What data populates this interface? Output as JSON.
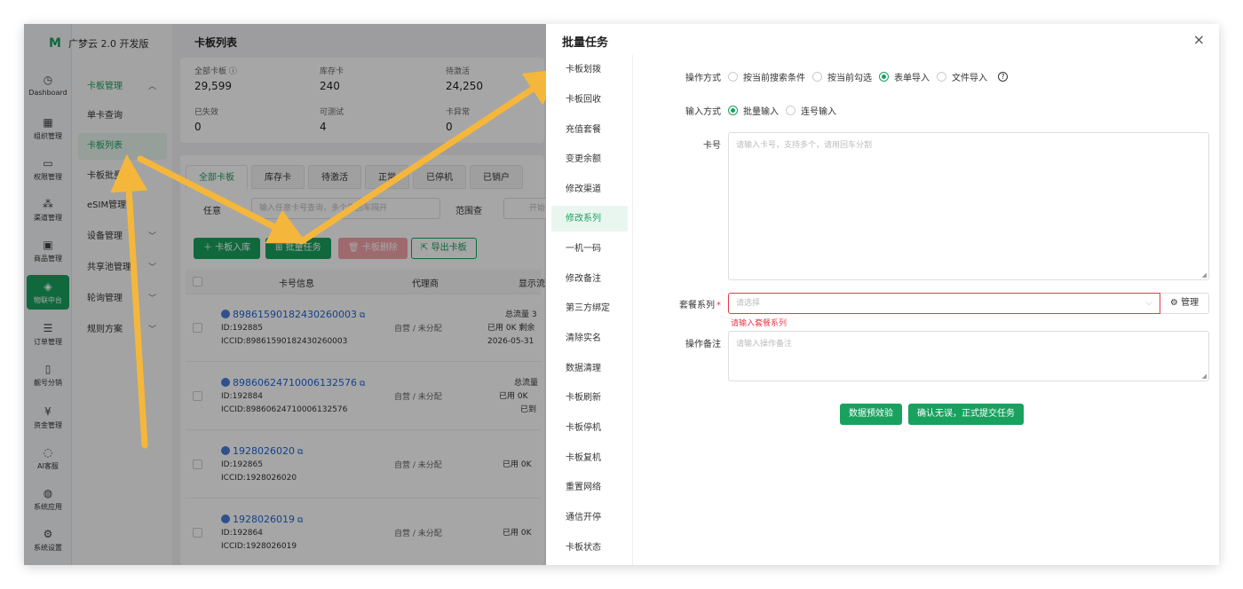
{
  "app": {
    "brand": "广梦云 2.0 开发版"
  },
  "nav_primary": [
    {
      "label": "Dashboard",
      "icon": "dashboard-icon"
    },
    {
      "label": "组织管理",
      "icon": "org-icon"
    },
    {
      "label": "权限管理",
      "icon": "permission-icon"
    },
    {
      "label": "渠道管理",
      "icon": "channel-icon"
    },
    {
      "label": "商品管理",
      "icon": "goods-icon"
    },
    {
      "label": "物联中台",
      "icon": "iot-icon",
      "active": true
    },
    {
      "label": "订单管理",
      "icon": "order-icon"
    },
    {
      "label": "靓号分销",
      "icon": "phone-icon"
    },
    {
      "label": "资金管理",
      "icon": "funds-icon"
    },
    {
      "label": "AI客服",
      "icon": "ai-icon"
    },
    {
      "label": "系统应用",
      "icon": "apps-icon"
    },
    {
      "label": "系统设置",
      "icon": "settings-icon"
    }
  ],
  "nav_secondary": {
    "group": "卡板管理",
    "items": [
      "单卡查询",
      "卡板列表",
      "卡板批量",
      "eSIM管理",
      "设备管理",
      "共享池管理",
      "轮询管理",
      "规则方案"
    ]
  },
  "page": {
    "title": "卡板列表",
    "stats": [
      {
        "label": "全部卡板",
        "value": "29,599"
      },
      {
        "label": "库存卡",
        "value": "240"
      },
      {
        "label": "待激活",
        "value": "24,250"
      },
      {
        "label": "已失效",
        "value": "0"
      },
      {
        "label": "可测试",
        "value": "4"
      },
      {
        "label": "卡异常",
        "value": "0"
      }
    ],
    "tabs": [
      "全部卡板",
      "库存卡",
      "待激活",
      "正常",
      "已停机",
      "已销户"
    ],
    "filter": {
      "any_label": "任意",
      "any_placeholder": "输入任意卡号查询，多个用回车隔开",
      "range_label": "范围查",
      "range_placeholder": "开始"
    },
    "toolbar": {
      "import": "＋ 卡板入库",
      "batch": "批量任务",
      "delete": "卡板删除",
      "export": "导出卡板"
    },
    "table": {
      "headers": [
        "卡号信息",
        "代理商",
        "显示流"
      ],
      "rows": [
        {
          "number": "89861590182430260003",
          "id": "ID:192885",
          "iccid": "ICCID:89861590182430260003",
          "agent": "自营 / 未分配",
          "flow1": "总流量 3",
          "flow2": "已用 0K  剩余",
          "flow3": "2026-05-31"
        },
        {
          "number": "89860624710006132576",
          "id": "ID:192884",
          "iccid": "ICCID:89860624710006132576",
          "agent": "自营 / 未分配",
          "flow1": "总流量",
          "flow2": "已用 0K",
          "flow3": "已到"
        },
        {
          "number": "1928026020",
          "id": "ID:192865",
          "iccid": "ICCID:1928026020",
          "agent": "自营 / 未分配",
          "flow1": "",
          "flow2": "已用 0K",
          "flow3": ""
        },
        {
          "number": "1928026019",
          "id": "ID:192864",
          "iccid": "ICCID:1928026019",
          "agent": "自营 / 未分配",
          "flow1": "",
          "flow2": "已用 0K",
          "flow3": ""
        }
      ]
    }
  },
  "dialog": {
    "title": "批量任务",
    "close": "×",
    "menu": [
      "卡板划拨",
      "卡板回收",
      "充值套餐",
      "变更余额",
      "修改渠道",
      "修改系列",
      "一机一码",
      "修改备注",
      "第三方绑定",
      "清除实名",
      "数据清理",
      "卡板刷新",
      "卡板停机",
      "卡板复机",
      "重置网络",
      "通信开停",
      "卡板状态"
    ],
    "active_menu": "修改系列",
    "form": {
      "mode_label": "操作方式",
      "mode_options": [
        "按当前搜索条件",
        "按当前勾选",
        "表单导入",
        "文件导入"
      ],
      "mode_selected": "表单导入",
      "input_label": "输入方式",
      "input_options": [
        "批量输入",
        "连号输入"
      ],
      "input_selected": "批量输入",
      "card_label": "卡号",
      "card_placeholder": "请输入卡号，支持多个，请用回车分割",
      "series_label": "套餐系列",
      "series_required": "*",
      "series_placeholder": "请选择",
      "series_manage": "管理",
      "series_error": "请输入套餐系列",
      "remark_label": "操作备注",
      "remark_placeholder": "请输入操作备注",
      "precheck_button": "数据预效验",
      "submit_button": "确认无误，正式提交任务"
    }
  },
  "colors": {
    "accent": "#19a15f",
    "danger": "#e6394a",
    "arrow": "#f5b73b",
    "link": "#1f64d6"
  }
}
